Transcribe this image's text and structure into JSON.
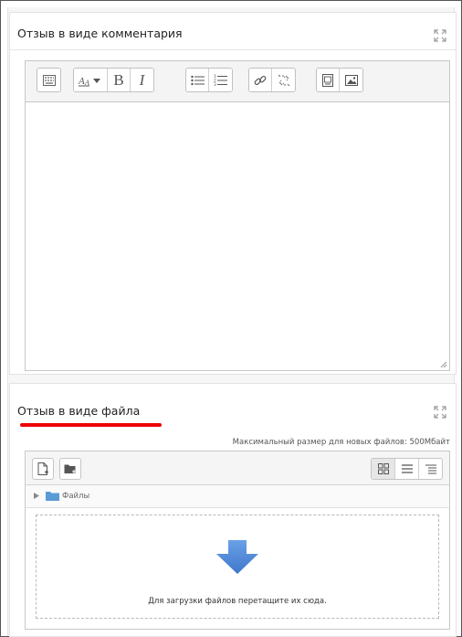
{
  "comment_section": {
    "title": "Отзыв в виде комментария"
  },
  "editor": {
    "toolbar_groups": [
      [
        "toolbar-toggle-icon"
      ],
      [
        "font-style-icon",
        "bold-icon",
        "italic-icon"
      ],
      [
        "unordered-list-icon",
        "ordered-list-icon"
      ],
      [
        "link-icon",
        "unlink-icon"
      ],
      [
        "media-icon",
        "image-icon"
      ]
    ],
    "bold_glyph": "B",
    "italic_glyph": "I"
  },
  "file_section": {
    "title": "Отзыв в виде файла",
    "max_size_text": "Максимальный размер для новых файлов: 500Мбайт",
    "path_label": "Файлы",
    "drop_text": "Для загрузки файлов перетащите их сюда.",
    "view_modes": [
      "icons",
      "list",
      "tree"
    ],
    "active_view": "icons"
  },
  "colors": {
    "underline": "#e00000",
    "drop_arrow": "#4a86d8",
    "folder": "#5a9ad5"
  }
}
